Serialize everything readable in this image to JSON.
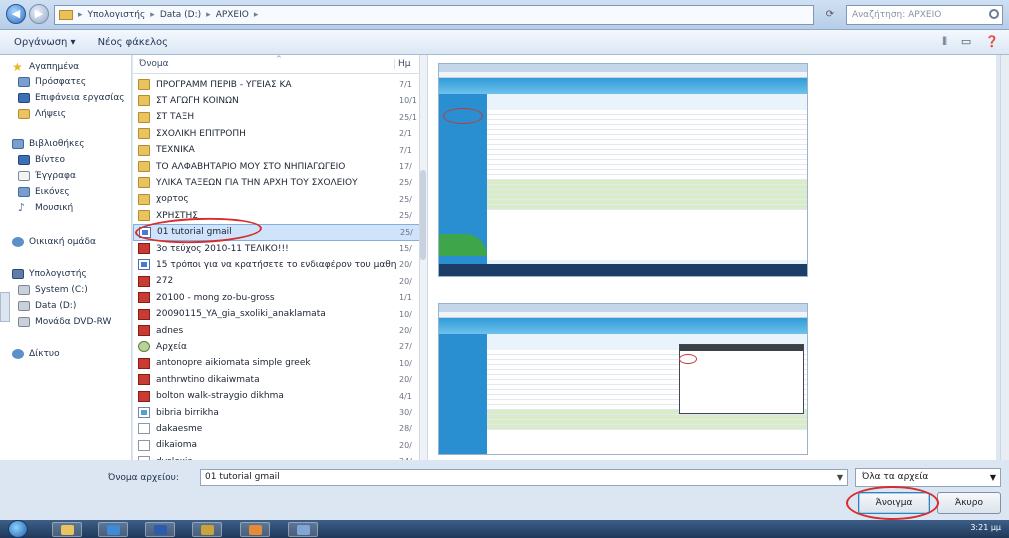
{
  "window": {
    "address_crumbs": [
      "Υπολογιστής",
      "Data (D:)",
      "ΑΡΧΕΙΟ"
    ],
    "search_placeholder": "Αναζήτηση: ΑΡΧΕΙΟ"
  },
  "toolbar": {
    "organize_label": "Οργάνωση ▾",
    "new_folder_label": "Νέος φάκελος"
  },
  "nav": {
    "items": [
      {
        "label": "Αγαπημένα",
        "icon": "star-icon"
      },
      {
        "label": "Πρόσφατες",
        "icon": "recent-places-icon"
      },
      {
        "label": "Επιφάνεια εργασίας",
        "icon": "desktop-icon"
      },
      {
        "label": "Λήψεις",
        "icon": "downloads-icon"
      },
      {
        "label": "Βιβλιοθήκες",
        "icon": "libraries-icon"
      },
      {
        "label": "Βίντεο",
        "icon": "videos-icon"
      },
      {
        "label": "Έγγραφα",
        "icon": "documents-icon"
      },
      {
        "label": "Εικόνες",
        "icon": "pictures-icon"
      },
      {
        "label": "Μουσική",
        "icon": "music-icon"
      },
      {
        "label": "Οικιακή ομάδα",
        "icon": "homegroup-icon"
      },
      {
        "label": "Υπολογιστής",
        "icon": "computer-icon"
      },
      {
        "label": "System (C:)",
        "icon": "drive-icon"
      },
      {
        "label": "Data (D:)",
        "icon": "drive-icon"
      },
      {
        "label": "Μονάδα DVD-RW",
        "icon": "dvd-icon"
      },
      {
        "label": "Δίκτυο",
        "icon": "network-icon"
      }
    ]
  },
  "filelist": {
    "col_name": "Όνομα",
    "col_date": "Ημ",
    "files": [
      {
        "name": "ΠΡΟΓΡΑΜΜ ΠΕΡΙΒ - ΥΓΕΙΑΣ ΚΑ",
        "date": "7/1",
        "type": "folder"
      },
      {
        "name": "ΣΤ ΑΓΩΓΗ ΚΟΙΝΩΝ",
        "date": "10/1",
        "type": "folder"
      },
      {
        "name": "ΣΤ ΤΑΞΗ",
        "date": "25/1",
        "type": "folder"
      },
      {
        "name": "ΣΧΟΛΙΚΗ ΕΠΙΤΡΟΠΗ",
        "date": "2/1",
        "type": "folder"
      },
      {
        "name": "ΤΕΧΝΙΚΑ",
        "date": "7/1",
        "type": "folder"
      },
      {
        "name": "ΤΟ ΑΛΦΑΒΗΤΑΡΙΟ ΜΟΥ ΣΤΟ ΝΗΠΙΑΓΩΓΕΙΟ",
        "date": "17/",
        "type": "folder"
      },
      {
        "name": "ΥΛΙΚΑ ΤΑΞΕΩΝ ΓΙΑ ΤΗΝ ΑΡΧΗ ΤΟΥ ΣΧΟΛΕΙΟΥ",
        "date": "25/",
        "type": "folder"
      },
      {
        "name": "χορτος",
        "date": "25/",
        "type": "folder"
      },
      {
        "name": "ΧΡΗΣΤΗΣ",
        "date": "25/",
        "type": "folder"
      },
      {
        "name": "01 tutorial gmail",
        "date": "25/",
        "type": "doc"
      },
      {
        "name": "3ο τεύχος 2010-11 ΤΕΛΙΚΟ!!!",
        "date": "15/",
        "type": "pdf"
      },
      {
        "name": "15 τρόποι για να κρατήσετε το ενδιαφέρον του μαθητή τ...",
        "date": "20/",
        "type": "doc"
      },
      {
        "name": "272",
        "date": "20/",
        "type": "pdf"
      },
      {
        "name": "20100 - mong zo-bu-gross",
        "date": "1/1",
        "type": "pdf"
      },
      {
        "name": "20090115_YA_gia_sxoliki_anaklamata",
        "date": "10/",
        "type": "pdf"
      },
      {
        "name": "adnes",
        "date": "20/",
        "type": "pdf"
      },
      {
        "name": "Αρχεία",
        "date": "27/",
        "type": "acc"
      },
      {
        "name": "antonopre aikiomata simple greek",
        "date": "10/",
        "type": "pdf"
      },
      {
        "name": "anthrwtino dikaiwmata",
        "date": "20/",
        "type": "pdf"
      },
      {
        "name": "bolton walk-straygio dikhma",
        "date": "4/1",
        "type": "pdf"
      },
      {
        "name": "bibria birrikha",
        "date": "30/",
        "type": "img"
      },
      {
        "name": "dakaesme",
        "date": "28/",
        "type": "txt"
      },
      {
        "name": "dikaioma",
        "date": "20/",
        "type": "txt"
      },
      {
        "name": "dyslexia",
        "date": "24/",
        "type": "txt"
      }
    ]
  },
  "bottom": {
    "filename_label": "Όνομα αρχείου:",
    "filename_value": "01 tutorial gmail",
    "filter_value": "Όλα τα αρχεία",
    "open_label": "Άνοιγμα",
    "cancel_label": "Άκυρο"
  },
  "tray": {
    "time": "3:21 μμ"
  }
}
